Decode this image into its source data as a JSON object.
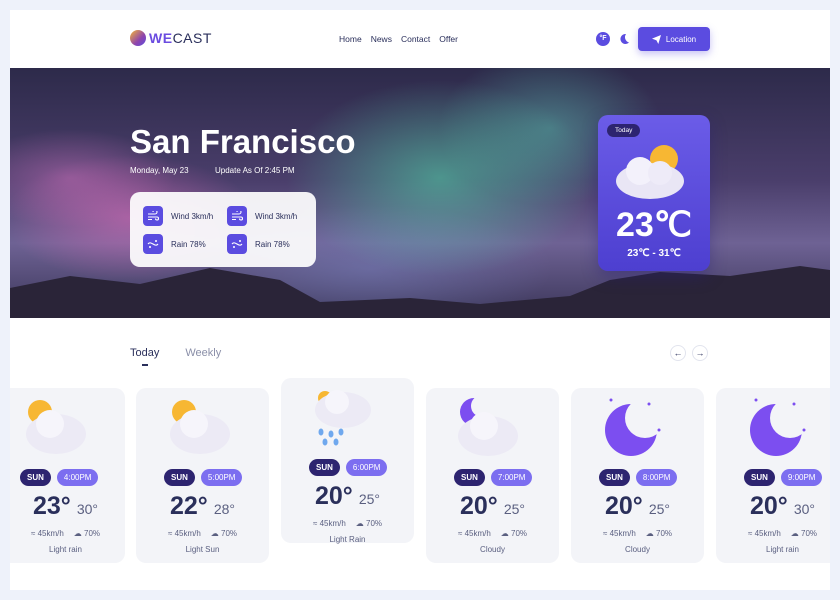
{
  "logo": {
    "we": "WE",
    "cast": "CAST"
  },
  "nav": [
    "Home",
    "News",
    "Contact",
    "Offer"
  ],
  "header": {
    "unit_label": "°F",
    "location_label": "Location"
  },
  "hero": {
    "city": "San Francisco",
    "date": "Monday, May 23",
    "update": "Update As Of 2:45 PM",
    "stats": [
      {
        "icon": "wind-icon",
        "label": "Wind 3km/h"
      },
      {
        "icon": "wind-icon",
        "label": "Wind 3km/h"
      },
      {
        "icon": "rain-icon",
        "label": "Rain 78%"
      },
      {
        "icon": "rain-icon",
        "label": "Rain 78%"
      }
    ]
  },
  "today_card": {
    "badge": "Today",
    "temp": "23℃",
    "range": "23℃ - 31℃"
  },
  "tabs": [
    "Today",
    "Weekly"
  ],
  "forecast": [
    {
      "icon": "sun-cloud-icon",
      "day": "SUN",
      "time": "4:00PM",
      "hi": "23°",
      "lo": "30°",
      "wind": "45km/h",
      "rain": "70%",
      "condition": "Light rain"
    },
    {
      "icon": "sun-cloud-icon",
      "day": "SUN",
      "time": "5:00PM",
      "hi": "22°",
      "lo": "28°",
      "wind": "45km/h",
      "rain": "70%",
      "condition": "Light Sun"
    },
    {
      "icon": "rain-cloud-icon",
      "day": "SUN",
      "time": "6:00PM",
      "hi": "20°",
      "lo": "25°",
      "wind": "45km/h",
      "rain": "70%",
      "condition": "Light Rain"
    },
    {
      "icon": "moon-cloud-icon",
      "day": "SUN",
      "time": "7:00PM",
      "hi": "20°",
      "lo": "25°",
      "wind": "45km/h",
      "rain": "70%",
      "condition": "Cloudy"
    },
    {
      "icon": "moon-icon",
      "day": "SUN",
      "time": "8:00PM",
      "hi": "20°",
      "lo": "25°",
      "wind": "45km/h",
      "rain": "70%",
      "condition": "Cloudy"
    },
    {
      "icon": "moon-icon",
      "day": "SUN",
      "time": "9:00PM",
      "hi": "20°",
      "lo": "30°",
      "wind": "45km/h",
      "rain": "70%",
      "condition": "Light rain"
    }
  ],
  "colors": {
    "accent": "#5b4ce0",
    "dark": "#2d2470",
    "text": "#2a2f5b",
    "time_badge": "#7c6ef0"
  }
}
